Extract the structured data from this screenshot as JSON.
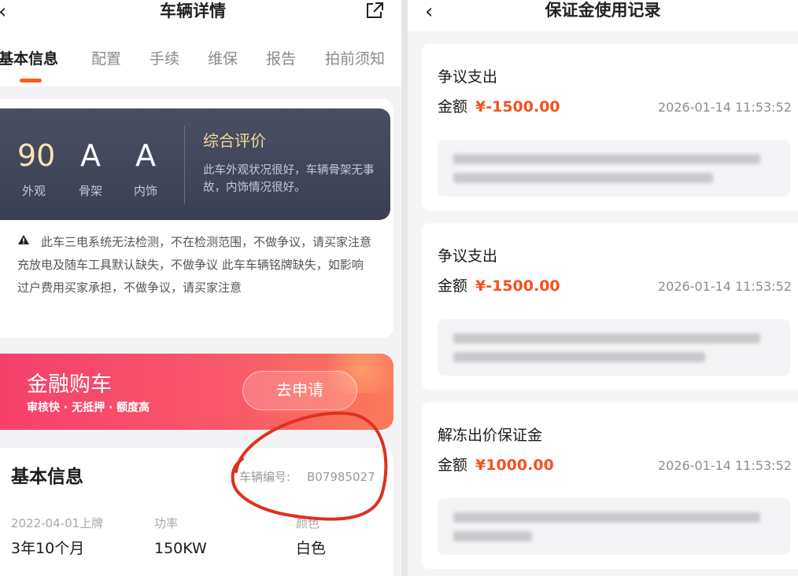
{
  "left": {
    "title": "车辆详情",
    "tabs": [
      "基本信息",
      "配置",
      "手续",
      "维保",
      "报告",
      "拍前须知"
    ],
    "rating": {
      "scores": [
        {
          "value": "90",
          "label": "外观"
        },
        {
          "value": "A",
          "label": "骨架"
        },
        {
          "value": "A",
          "label": "内饰"
        }
      ],
      "overall_title": "综合评价",
      "overall_desc": "此车外观状况很好，车辆骨架无事故，内饰情况很好。"
    },
    "notice": "此车三电系统无法检测，不在检测范围，不做争议，请买家注意 充放电及随车工具默认缺失，不做争议 此车车辆铭牌缺失，如影响过户费用买家承担，不做争议，请买家注意",
    "finance": {
      "title": "金融购车",
      "subtitle": "审核快 · 无抵押 · 额度高",
      "button": "去申请"
    },
    "basic": {
      "title": "基本信息",
      "vehicle_no_label": "车辆编号:",
      "vehicle_no": "B07985027",
      "items": [
        {
          "label": "2022-04-01上牌",
          "value": "3年10个月"
        },
        {
          "label": "功率",
          "value": "150KW"
        },
        {
          "label": "颜色",
          "value": "白色"
        }
      ]
    },
    "colors": {
      "accent": "#ff5a1f",
      "finance_start": "#f6406b",
      "annotation": "#e0301e"
    }
  },
  "right": {
    "title": "保证金使用记录",
    "amount_label": "金额",
    "records": [
      {
        "title": "争议支出",
        "amount": "¥-1500.00",
        "time": "2026-01-14 11:53:52"
      },
      {
        "title": "争议支出",
        "amount": "¥-1500.00",
        "time": "2026-01-14 11:53:52"
      },
      {
        "title": "解冻出价保证金",
        "amount": "¥1000.00",
        "time": "2026-01-14 11:53:52"
      }
    ],
    "colors": {
      "amount": "#f4511e"
    }
  }
}
